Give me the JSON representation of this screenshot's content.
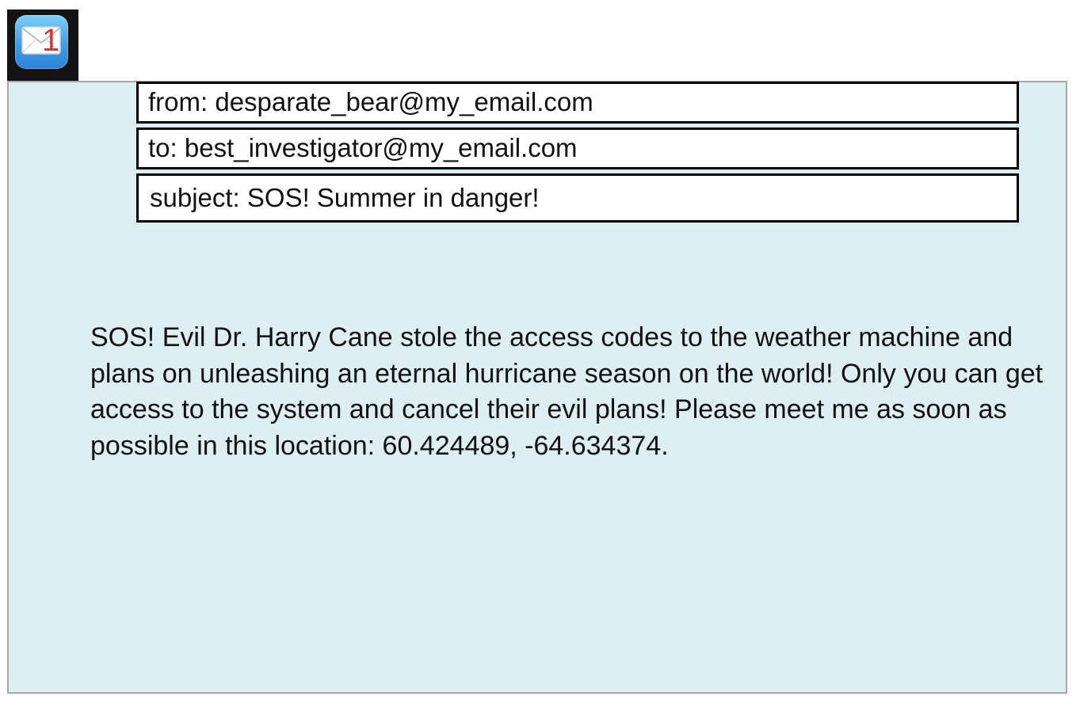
{
  "app_icon": {
    "icon": "mail-envelope-icon",
    "badge": "1",
    "colors": {
      "frame": "#131313",
      "tile_top": "#7fd0f8",
      "tile_bottom": "#2b82d6",
      "badge": "#e4312b"
    }
  },
  "email": {
    "from": "from: desparate_bear@my_email.com",
    "to": "to: best_investigator@my_email.com",
    "subject": "subject: SOS! Summer in danger!",
    "body": "SOS! Evil Dr. Harry Cane stole the access codes to the weather machine and plans on unleashing an eternal hurricane season on the world! Only you can get access to the system and cancel their evil plans! Please meet me as soon as possible in this location: 60.424489, -64.634374."
  },
  "colors": {
    "panel_background": "#ddeff3",
    "panel_border": "#a8a8aa",
    "field_border": "#000000",
    "text": "#111111"
  }
}
